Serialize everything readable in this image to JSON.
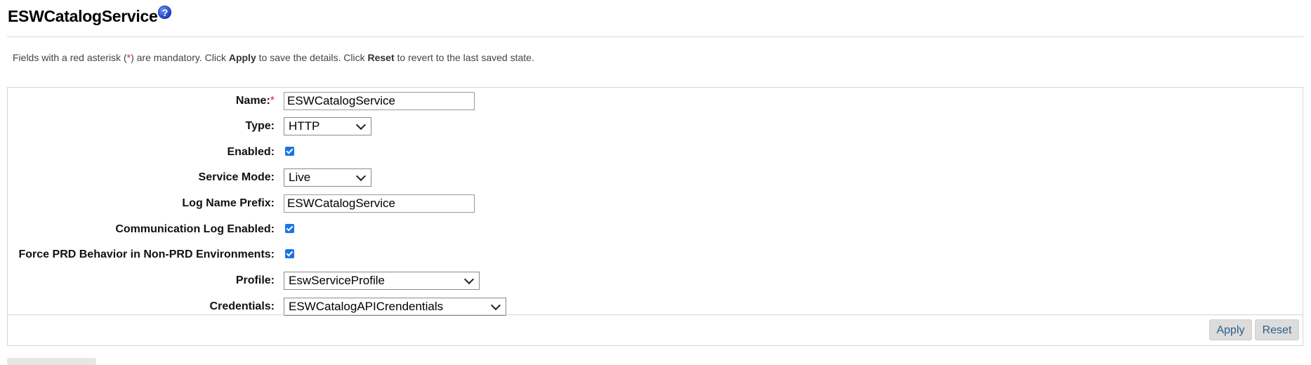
{
  "header": {
    "title": "ESWCatalogService",
    "help_icon_glyph": "?"
  },
  "instructions": {
    "part1": "Fields with a red asterisk (",
    "asterisk": "*",
    "part2": ") are mandatory. Click ",
    "apply_word": "Apply",
    "part3": " to save the details. Click ",
    "reset_word": "Reset",
    "part4": " to revert to the last saved state."
  },
  "form": {
    "name": {
      "label": "Name:",
      "required_mark": "*",
      "value": "ESWCatalogService"
    },
    "type": {
      "label": "Type:",
      "value": "HTTP"
    },
    "enabled": {
      "label": "Enabled:",
      "checked": true
    },
    "service_mode": {
      "label": "Service Mode:",
      "value": "Live"
    },
    "log_name_prefix": {
      "label": "Log Name Prefix:",
      "value": "ESWCatalogService"
    },
    "communication_log": {
      "label": "Communication Log Enabled:",
      "checked": true
    },
    "force_prd": {
      "label": "Force PRD Behavior in Non-PRD Environments:",
      "checked": true
    },
    "profile": {
      "label": "Profile:",
      "value": "EswServiceProfile"
    },
    "credentials": {
      "label": "Credentials:",
      "value": "ESWCatalogAPICrendentials"
    }
  },
  "actions": {
    "apply_label": "Apply",
    "reset_label": "Reset"
  },
  "colors": {
    "required": "#e02020",
    "checkbox": "#1a73e8",
    "button_text": "#2a5e8c"
  }
}
